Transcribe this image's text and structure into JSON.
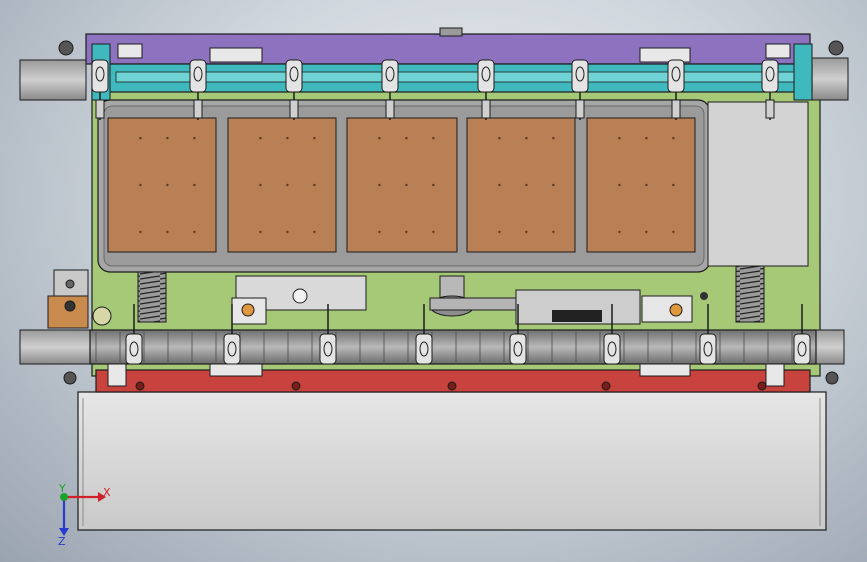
{
  "viewport": {
    "background_top": "#e9edf1",
    "background_edge": "#9aa4b0"
  },
  "model": {
    "colors": {
      "top_plate": "#8c72bf",
      "cyan_rail": "#3fb9bd",
      "green_base": "#a6c977",
      "pad": "#b97f55",
      "tray": "#a6a6a6",
      "bottom_rail": "#c8433e",
      "chain": "#8c8c8c",
      "lower_box": "#d7d7d7",
      "outline": "#1c1c1c"
    },
    "pad_count": 5,
    "top_clamp_count": 8,
    "bottom_clamp_count": 8,
    "spring_count": 2
  },
  "triad": {
    "x_label": "X",
    "y_label": "Y",
    "z_label": "Z",
    "x_color": "#d0202a",
    "y_color": "#1aa12a",
    "z_color": "#2a3bd0"
  }
}
